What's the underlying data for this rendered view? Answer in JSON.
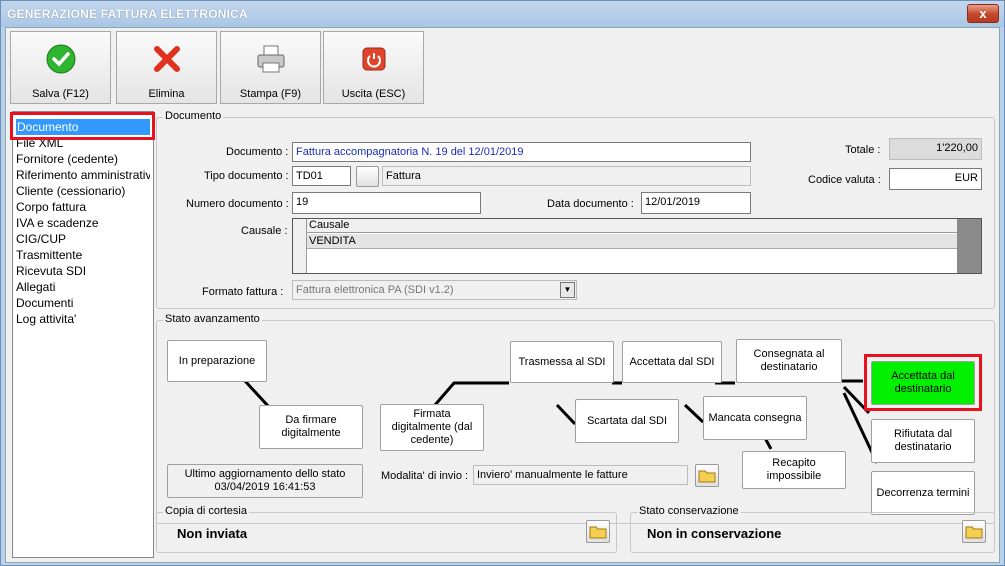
{
  "window": {
    "title": "GENERAZIONE FATTURA ELETTRONICA",
    "close_label": "x"
  },
  "toolbar": [
    {
      "label": "Salva (F12)",
      "icon": "check-icon"
    },
    {
      "label": "Elimina",
      "icon": "delete-x-icon"
    },
    {
      "label": "Stampa (F9)",
      "icon": "printer-icon"
    },
    {
      "label": "Uscita (ESC)",
      "icon": "power-icon"
    }
  ],
  "nav": {
    "items": [
      "Documento",
      "File XML",
      "Fornitore (cedente)",
      "Riferimento amministrativo",
      "Cliente (cessionario)",
      "Corpo fattura",
      "IVA e scadenze",
      "CIG/CUP",
      "Trasmittente",
      "Ricevuta SDI",
      "Allegati",
      "Documenti",
      "Log attivita'"
    ],
    "selected": "Documento"
  },
  "documento": {
    "group_label": "Documento",
    "documento_label": "Documento :",
    "documento_value": "Fattura accompagnatoria N. 19 del 12/01/2019",
    "tipo_label": "Tipo documento :",
    "tipo_code": "TD01",
    "tipo_desc": "Fattura",
    "numero_label": "Numero documento :",
    "numero_value": "19",
    "data_label": "Data documento :",
    "data_value": "12/01/2019",
    "causale_label": "Causale :",
    "causale_header": "Causale",
    "causale_rows": [
      "VENDITA"
    ],
    "formato_label": "Formato fattura :",
    "formato_value": "Fattura elettronica PA (SDI v1.2)",
    "totale_label": "Totale :",
    "totale_value": "1'220,00",
    "valuta_label": "Codice valuta :",
    "valuta_value": "EUR"
  },
  "stato": {
    "group_label": "Stato avanzamento",
    "nodes": {
      "preparazione": "In preparazione",
      "da_firmare": "Da firmare digitalmente",
      "firmata": "Firmata digitalmente (dal cedente)",
      "trasmessa": "Trasmessa al SDI",
      "scartata": "Scartata dal SDI",
      "accettata_sdi": "Accettata dal SDI",
      "mancata": "Mancata consegna",
      "consegnata": "Consegnata al destinatario",
      "recapito": "Recapito impossibile",
      "accettata_dest": "Accettata dal destinatario",
      "rifiutata": "Rifiutata dal destinatario",
      "decorrenza": "Decorrenza termini"
    },
    "active_color": "#00f000",
    "ultimo_label": "Ultimo aggiornamento dello stato",
    "ultimo_value": "03/04/2019 16:41:53",
    "modalita_label": "Modalita' di invio :",
    "modalita_value": "Inviero' manualmente le fatture"
  },
  "copia": {
    "group_label": "Copia di cortesia",
    "value": "Non inviata"
  },
  "conservazione": {
    "group_label": "Stato conservazione",
    "value": "Non in conservazione"
  }
}
